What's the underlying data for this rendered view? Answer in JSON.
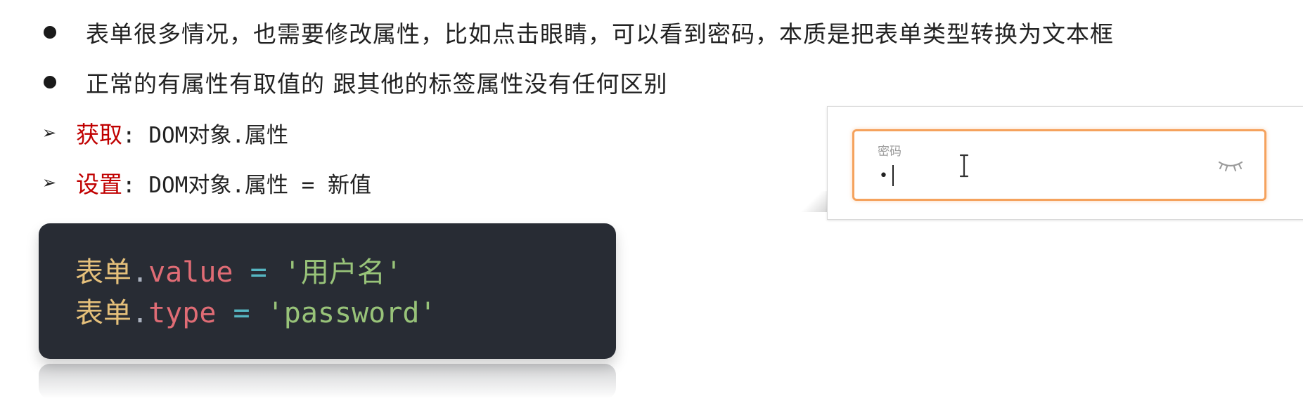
{
  "bullets": [
    {
      "text": "表单很多情况，也需要修改属性，比如点击眼睛，可以看到密码，本质是把表单类型转换为文本框"
    },
    {
      "text": "正常的有属性有取值的 跟其他的标签属性没有任何区别"
    }
  ],
  "get_item": {
    "label": "获取",
    "rest": ": DOM对象.属性"
  },
  "set_item": {
    "label": "设置",
    "rest": ": DOM对象.属性 = 新值"
  },
  "code": {
    "line1": {
      "obj": "表单",
      "dot": ".",
      "prop": "value",
      "op": " = ",
      "str": "'用户名'"
    },
    "line2": {
      "obj": "表单",
      "dot": ".",
      "prop": "type",
      "op": " = ",
      "str": "'password'"
    }
  },
  "password_field": {
    "label": "密码",
    "value": "•"
  },
  "colors": {
    "accent_red": "#c00000",
    "field_border": "#f5a25d",
    "code_bg": "#282c34"
  },
  "icons": [
    "bullet-dot-icon",
    "arrow-right-icon",
    "ibeam-cursor-icon",
    "eye-closed-icon"
  ]
}
